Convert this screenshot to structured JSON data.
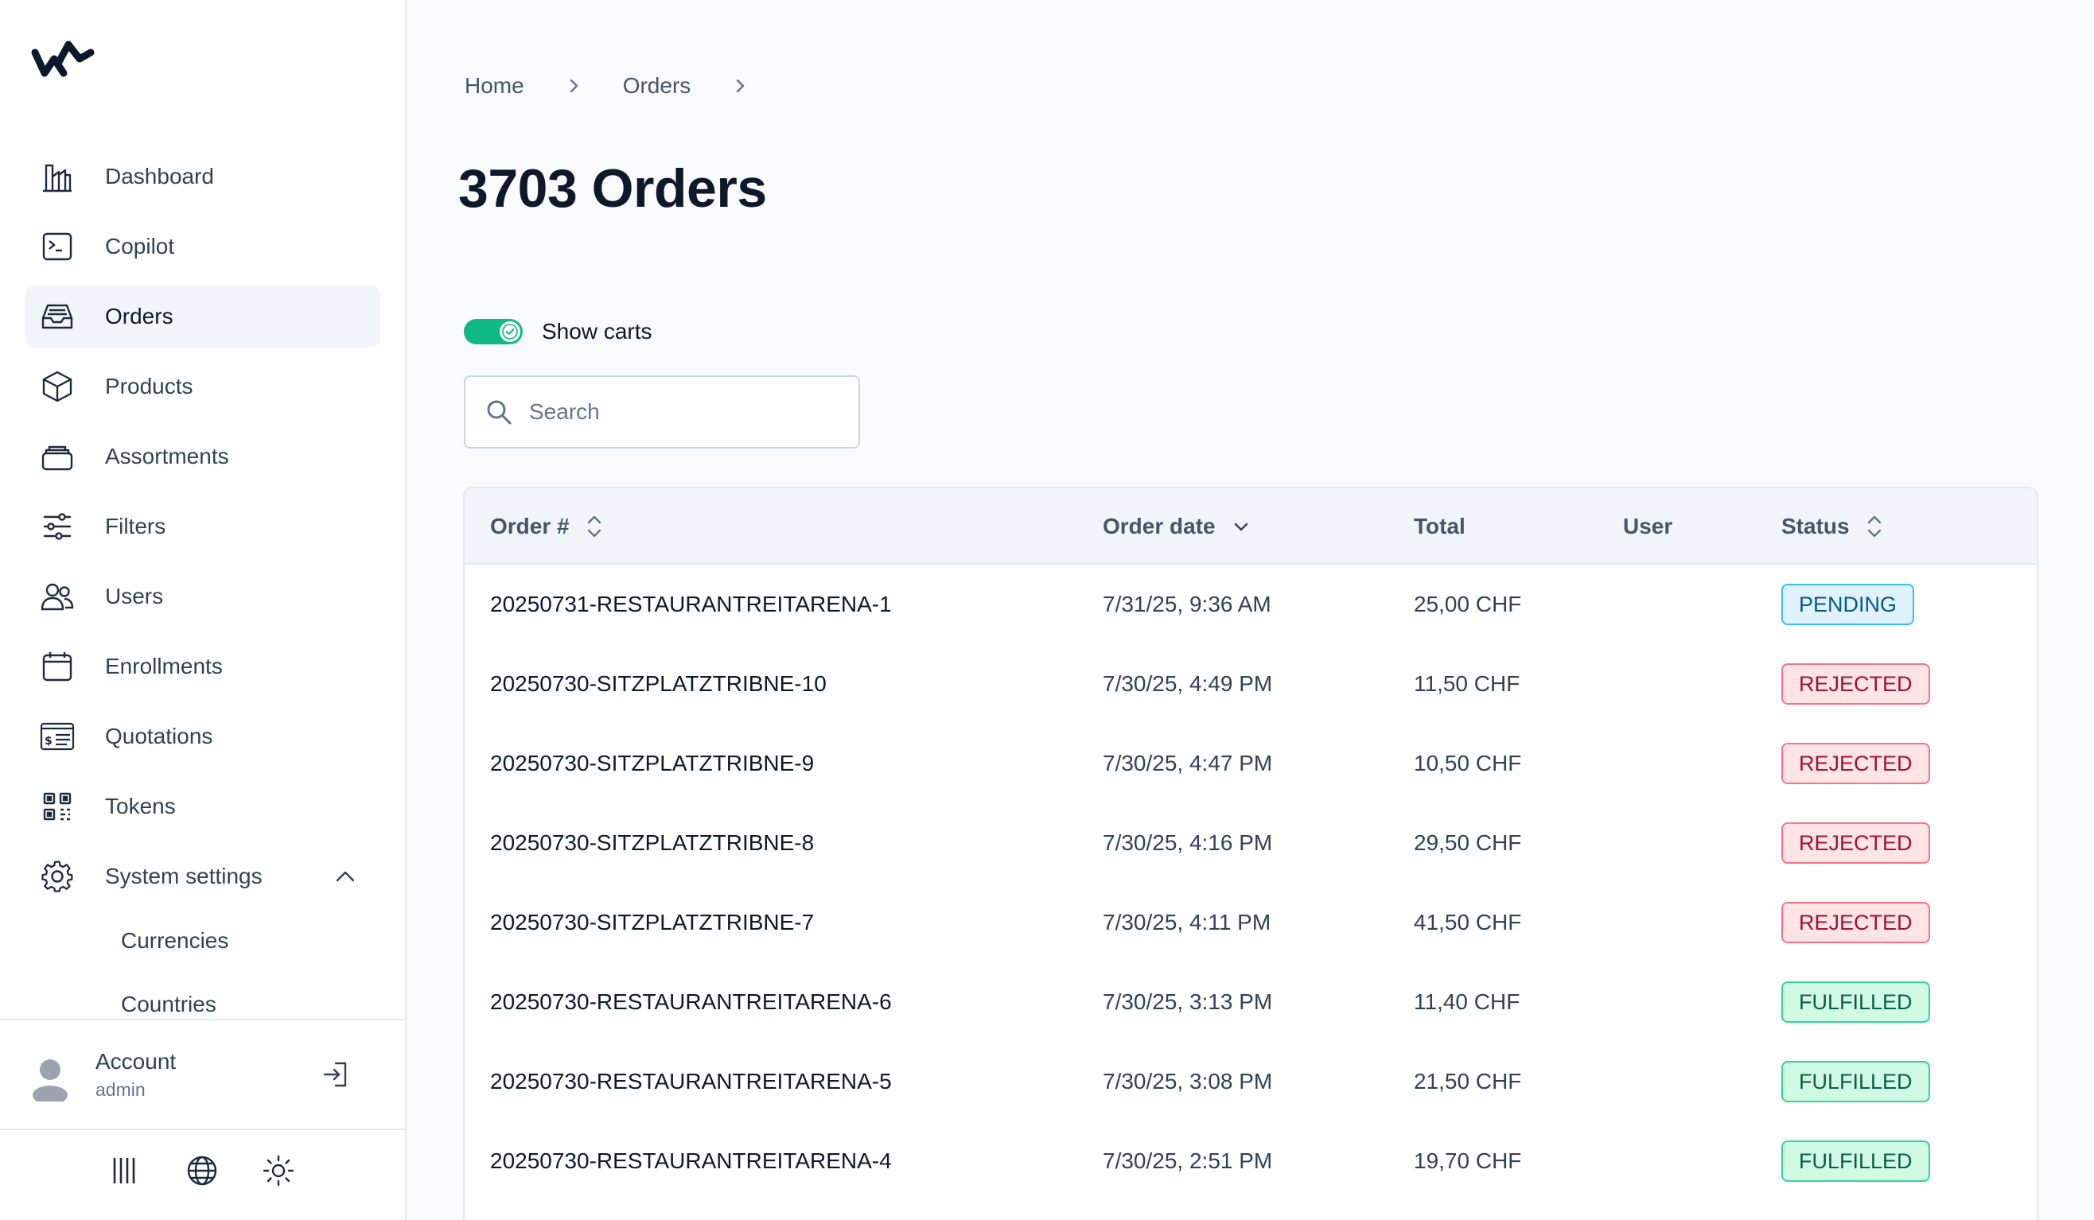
{
  "sidebar": {
    "items": [
      {
        "label": "Dashboard",
        "icon": "dashboard-icon"
      },
      {
        "label": "Copilot",
        "icon": "terminal-icon"
      },
      {
        "label": "Orders",
        "icon": "inbox-icon"
      },
      {
        "label": "Products",
        "icon": "cube-icon"
      },
      {
        "label": "Assortments",
        "icon": "stack-icon"
      },
      {
        "label": "Filters",
        "icon": "sliders-icon"
      },
      {
        "label": "Users",
        "icon": "users-icon"
      },
      {
        "label": "Enrollments",
        "icon": "calendar-icon"
      },
      {
        "label": "Quotations",
        "icon": "quotation-icon"
      },
      {
        "label": "Tokens",
        "icon": "qr-code-icon"
      },
      {
        "label": "System settings",
        "icon": "gear-icon"
      }
    ],
    "active": "Orders",
    "sub_items": [
      "Currencies",
      "Countries"
    ],
    "account": {
      "name": "Account",
      "role": "admin"
    }
  },
  "breadcrumb": [
    "Home",
    "Orders"
  ],
  "page_title": "3703 Orders",
  "show_carts": {
    "label": "Show carts",
    "enabled": true
  },
  "search": {
    "placeholder": "Search",
    "value": ""
  },
  "table": {
    "headers": {
      "order": "Order #",
      "date": "Order date",
      "total": "Total",
      "user": "User",
      "status": "Status"
    },
    "rows": [
      {
        "order": "20250731-RESTAURANTREITARENA-1",
        "date": "7/31/25, 9:36 AM",
        "total": "25,00 CHF",
        "user": "",
        "status": "PENDING"
      },
      {
        "order": "20250730-SITZPLATZTRIBNE-10",
        "date": "7/30/25, 4:49 PM",
        "total": "11,50 CHF",
        "user": "",
        "status": "REJECTED"
      },
      {
        "order": "20250730-SITZPLATZTRIBNE-9",
        "date": "7/30/25, 4:47 PM",
        "total": "10,50 CHF",
        "user": "",
        "status": "REJECTED"
      },
      {
        "order": "20250730-SITZPLATZTRIBNE-8",
        "date": "7/30/25, 4:16 PM",
        "total": "29,50 CHF",
        "user": "",
        "status": "REJECTED"
      },
      {
        "order": "20250730-SITZPLATZTRIBNE-7",
        "date": "7/30/25, 4:11 PM",
        "total": "41,50 CHF",
        "user": "",
        "status": "REJECTED"
      },
      {
        "order": "20250730-RESTAURANTREITARENA-6",
        "date": "7/30/25, 3:13 PM",
        "total": "11,40 CHF",
        "user": "",
        "status": "FULFILLED"
      },
      {
        "order": "20250730-RESTAURANTREITARENA-5",
        "date": "7/30/25, 3:08 PM",
        "total": "21,50 CHF",
        "user": "",
        "status": "FULFILLED"
      },
      {
        "order": "20250730-RESTAURANTREITARENA-4",
        "date": "7/30/25, 2:51 PM",
        "total": "19,70 CHF",
        "user": "",
        "status": "FULFILLED"
      }
    ]
  },
  "colors": {
    "accent": "#10b981",
    "pending": "#38bdf8",
    "rejected": "#fb7185",
    "fulfilled": "#34d399"
  }
}
